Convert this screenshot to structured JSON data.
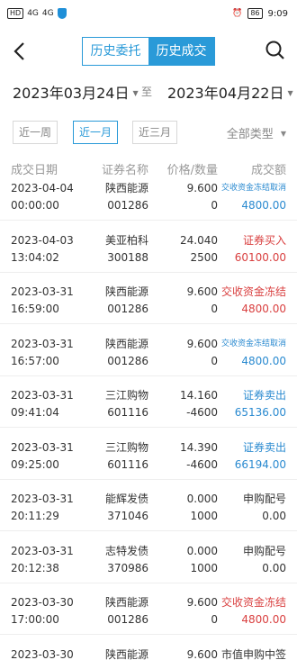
{
  "status_bar": {
    "left_items": [
      "HD",
      "4G",
      "4G"
    ],
    "battery": "86",
    "time": "9:09"
  },
  "nav": {
    "tabs": [
      {
        "label": "历史委托",
        "active": false
      },
      {
        "label": "历史成交",
        "active": true
      }
    ]
  },
  "date_range": {
    "start": "2023年03月24日",
    "separator": "至",
    "end": "2023年04月22日"
  },
  "filters": {
    "periods": [
      {
        "label": "近一周",
        "active": false
      },
      {
        "label": "近一月",
        "active": true
      },
      {
        "label": "近三月",
        "active": false
      }
    ],
    "type_select": "全部类型"
  },
  "table": {
    "headers": [
      "成交日期",
      "证券名称",
      "价格/数量",
      "成交额"
    ],
    "rows": [
      {
        "date": "2023-04-04",
        "time": "00:00:00",
        "name": "陕西能源",
        "code": "001286",
        "price": "9.600",
        "qty": "0",
        "type": "交收资金冻结取消",
        "type_color": "blue",
        "type_small": true,
        "amount": "4800.00",
        "amount_color": "blue"
      },
      {
        "date": "2023-04-03",
        "time": "13:04:02",
        "name": "美亚柏科",
        "code": "300188",
        "price": "24.040",
        "qty": "2500",
        "type": "证券买入",
        "type_color": "red",
        "type_small": false,
        "amount": "60100.00",
        "amount_color": "red"
      },
      {
        "date": "2023-03-31",
        "time": "16:59:00",
        "name": "陕西能源",
        "code": "001286",
        "price": "9.600",
        "qty": "0",
        "type": "交收资金冻结",
        "type_color": "red",
        "type_small": false,
        "amount": "4800.00",
        "amount_color": "red"
      },
      {
        "date": "2023-03-31",
        "time": "16:57:00",
        "name": "陕西能源",
        "code": "001286",
        "price": "9.600",
        "qty": "0",
        "type": "交收资金冻结取消",
        "type_color": "blue",
        "type_small": true,
        "amount": "4800.00",
        "amount_color": "blue"
      },
      {
        "date": "2023-03-31",
        "time": "09:41:04",
        "name": "三江购物",
        "code": "601116",
        "price": "14.160",
        "qty": "-4600",
        "type": "证券卖出",
        "type_color": "blue",
        "type_small": false,
        "amount": "65136.00",
        "amount_color": "blue"
      },
      {
        "date": "2023-03-31",
        "time": "09:25:00",
        "name": "三江购物",
        "code": "601116",
        "price": "14.390",
        "qty": "-4600",
        "type": "证券卖出",
        "type_color": "blue",
        "type_small": false,
        "amount": "66194.00",
        "amount_color": "blue"
      },
      {
        "date": "2023-03-31",
        "time": "20:11:29",
        "name": "能辉发债",
        "code": "371046",
        "price": "0.000",
        "qty": "1000",
        "type": "申购配号",
        "type_color": "black",
        "type_small": false,
        "amount": "0.00",
        "amount_color": "black"
      },
      {
        "date": "2023-03-31",
        "time": "20:12:38",
        "name": "志特发债",
        "code": "370986",
        "price": "0.000",
        "qty": "1000",
        "type": "申购配号",
        "type_color": "black",
        "type_small": false,
        "amount": "0.00",
        "amount_color": "black"
      },
      {
        "date": "2023-03-30",
        "time": "17:00:00",
        "name": "陕西能源",
        "code": "001286",
        "price": "9.600",
        "qty": "0",
        "type": "交收资金冻结",
        "type_color": "red",
        "type_small": false,
        "amount": "4800.00",
        "amount_color": "red"
      },
      {
        "date": "2023-03-30",
        "time": "00:00:00",
        "name": "陕西能源",
        "code": "001286",
        "price": "9.600",
        "qty": "500",
        "type": "市值申购中签",
        "type_color": "black",
        "type_small": false,
        "amount": "0.00",
        "amount_color": "black"
      }
    ]
  }
}
